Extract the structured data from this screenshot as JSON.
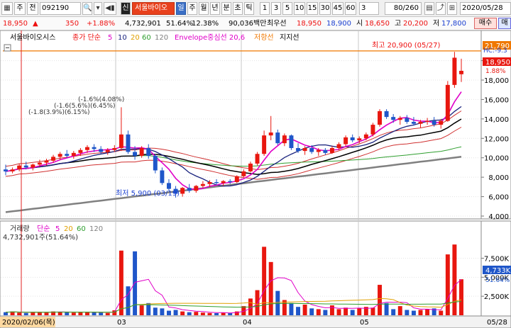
{
  "toolbar": {
    "menu_icon": "▦",
    "market_label": "주",
    "prev_label": "전",
    "code": "092190",
    "search_icon": "🔍",
    "window_icons": [
      "▾",
      "◀",
      "▶"
    ],
    "speaker_icon": "◀▮",
    "sin_label": "신",
    "stock_name": "서울바이오",
    "periods": [
      "일",
      "주",
      "월",
      "년",
      "분",
      "초",
      "틱"
    ],
    "minute_options": [
      "1",
      "3",
      "5",
      "10",
      "15",
      "30",
      "45",
      "60"
    ],
    "interval_value": "3",
    "count_value": "80/260",
    "tool_icons": [
      "▤",
      "⤴",
      "⊞"
    ],
    "date_value": "2020/05/28"
  },
  "info": {
    "price": "18,950",
    "arrow": "▲",
    "change": "350",
    "change_rate": "+1.88%",
    "volume": "4,732,901",
    "turnover": "51.64%",
    "trade_value_ratio": "12.38%",
    "amount": "90,036백만",
    "priority_label": "최우선",
    "ask": "18,950",
    "bid": "18,900",
    "open_label": "시",
    "open": "18,650",
    "high_label": "고",
    "high": "20,200",
    "low_label": "저",
    "low": "17,800",
    "buy_label": "매수",
    "sell_label": "매"
  },
  "chart": {
    "legend": {
      "name": "서울바이오시스",
      "ma_prefix": "종가 단순",
      "periods": [
        "5",
        "10",
        "20",
        "60",
        "120"
      ],
      "envelope": "Envelope중심선 20,6",
      "resistance": "저항선",
      "support": "지지선"
    },
    "price_axis": {
      "ticks": [
        "20,000",
        "18,000",
        "16,000",
        "14,000",
        "12,000",
        "10,000",
        "8,000",
        "6,000",
        "4,000"
      ],
      "current_price": "18,950",
      "current_rate": "1.88%",
      "resistance_value": "21,790",
      "hc_label": "HC:-9.3"
    },
    "annotations": {
      "high": "최고 20,900 (05/27)",
      "low": "최저 5,900 (03/19)",
      "signals_text": "(-1.6%(4.08%)",
      "signals_text2": "(-1.6(5.6%)(6.45%)",
      "signals_text3": "(-1.8(3.9%)(6.15%)"
    },
    "volume_legend": {
      "name": "거래량",
      "ma_prefix": "단순",
      "periods": [
        "5",
        "20",
        "60",
        "120"
      ],
      "value": "4,732,901주(51.64%)"
    },
    "volume_axis": {
      "ticks": [
        "7,500K",
        "5,000K",
        "2,500K"
      ],
      "current": "4,733K",
      "current_rate": "51.64%"
    },
    "date_axis": {
      "first_date": "2020/02/06(목)",
      "months": [
        "03",
        "04",
        "05"
      ],
      "last": "05/28"
    },
    "colors": {
      "up": "#e8170f",
      "down": "#1f56c9",
      "ma5": "#e000c8",
      "ma10": "#1a237e",
      "ma20": "#000000",
      "ma60": "#2e9e2e",
      "ma120": "#808080",
      "envelope": "#d03030",
      "resistance": "#f07800"
    }
  },
  "chart_data": [
    {
      "type": "candlestick",
      "title": "서울바이오시스",
      "x": [
        "2020-02-06",
        "2020-05-28"
      ],
      "ylim": [
        4000,
        21500
      ],
      "ohlc": [
        [
          8800,
          9300,
          8200,
          8600
        ],
        [
          8600,
          9000,
          8400,
          8800
        ],
        [
          8800,
          9400,
          8600,
          9200
        ],
        [
          9200,
          9600,
          8800,
          9000
        ],
        [
          9000,
          9400,
          8700,
          9300
        ],
        [
          9300,
          9800,
          9100,
          9500
        ],
        [
          9500,
          9900,
          9200,
          9700
        ],
        [
          9700,
          10300,
          9500,
          10100
        ],
        [
          10100,
          10600,
          9800,
          10400
        ],
        [
          10400,
          10800,
          10000,
          10200
        ],
        [
          10200,
          10700,
          9900,
          10500
        ],
        [
          10500,
          11000,
          10200,
          10800
        ],
        [
          10800,
          11300,
          10500,
          11100
        ],
        [
          11100,
          11400,
          10600,
          10900
        ],
        [
          10900,
          11200,
          10400,
          10600
        ],
        [
          10600,
          11000,
          10300,
          10800
        ],
        [
          10800,
          11300,
          10600,
          11000
        ],
        [
          11000,
          15200,
          10700,
          12400
        ],
        [
          12400,
          12800,
          10400,
          10600
        ],
        [
          10600,
          11200,
          9800,
          10200
        ],
        [
          10200,
          11200,
          10000,
          11000
        ],
        [
          11000,
          11400,
          9900,
          10200
        ],
        [
          10200,
          10400,
          8400,
          8700
        ],
        [
          8700,
          9000,
          7200,
          7400
        ],
        [
          7400,
          7800,
          6600,
          6800
        ],
        [
          6800,
          7100,
          5900,
          6300
        ],
        [
          6300,
          7000,
          6000,
          6900
        ],
        [
          6900,
          7300,
          6400,
          6600
        ],
        [
          6600,
          7200,
          6400,
          7100
        ],
        [
          7100,
          7600,
          6900,
          7300
        ],
        [
          7300,
          7700,
          7000,
          7500
        ],
        [
          7500,
          7800,
          7200,
          7400
        ],
        [
          7400,
          7700,
          7100,
          7600
        ],
        [
          7600,
          7800,
          7300,
          7500
        ],
        [
          7500,
          8200,
          7400,
          8100
        ],
        [
          8100,
          8800,
          8000,
          8600
        ],
        [
          8600,
          9600,
          8500,
          9400
        ],
        [
          9400,
          10600,
          9200,
          10400
        ],
        [
          10400,
          12800,
          10200,
          12300
        ],
        [
          12300,
          14300,
          11800,
          12600
        ],
        [
          12600,
          12900,
          11300,
          11500
        ],
        [
          11500,
          12500,
          11200,
          12300
        ],
        [
          12300,
          12400,
          10800,
          11000
        ],
        [
          11000,
          11500,
          10500,
          10700
        ],
        [
          10700,
          11200,
          10300,
          11000
        ],
        [
          11000,
          11300,
          10400,
          10600
        ],
        [
          10600,
          11000,
          10200,
          10800
        ],
        [
          10800,
          11000,
          10300,
          10500
        ],
        [
          10500,
          11200,
          10400,
          11000
        ],
        [
          11000,
          11600,
          10800,
          11400
        ],
        [
          11400,
          12300,
          11200,
          12100
        ],
        [
          12100,
          12400,
          11600,
          11800
        ],
        [
          11800,
          12200,
          11500,
          12000
        ],
        [
          12000,
          12600,
          11800,
          12400
        ],
        [
          12400,
          13600,
          12200,
          13400
        ],
        [
          13400,
          15000,
          13200,
          14800
        ],
        [
          14800,
          15000,
          14000,
          14200
        ],
        [
          14200,
          14500,
          13600,
          13900
        ],
        [
          13900,
          14300,
          13400,
          14100
        ],
        [
          14100,
          14400,
          13500,
          13700
        ],
        [
          13700,
          14200,
          13300,
          13500
        ],
        [
          13500,
          13900,
          13100,
          13700
        ],
        [
          13700,
          14100,
          13400,
          13800
        ],
        [
          13800,
          14200,
          13200,
          13400
        ],
        [
          13400,
          14000,
          13000,
          13800
        ],
        [
          13800,
          17900,
          13700,
          17500
        ],
        [
          17500,
          20900,
          17200,
          20300
        ],
        [
          18600,
          20200,
          17800,
          18950
        ]
      ],
      "ma120": [
        4400,
        10100
      ]
    },
    {
      "type": "bar",
      "title": "거래량",
      "ylim": [
        0,
        9500000
      ],
      "values": [
        400000,
        500000,
        350000,
        300000,
        450000,
        380000,
        420000,
        500000,
        450000,
        380000,
        350000,
        400000,
        450000,
        380000,
        350000,
        300000,
        650000,
        8500000,
        3800000,
        8400000,
        1300000,
        1600000,
        1000000,
        900000,
        600000,
        700000,
        500000,
        400000,
        450000,
        350000,
        300000,
        280000,
        320000,
        300000,
        500000,
        1200000,
        2200000,
        3300000,
        9000000,
        7000000,
        3200000,
        2000000,
        1600000,
        1100000,
        1400000,
        900000,
        800000,
        700000,
        1300000,
        800000,
        1000000,
        700000,
        900000,
        1100000,
        1000000,
        4000000,
        1600000,
        800000,
        1200000,
        700000,
        600000,
        700000,
        800000,
        900000,
        600000,
        8000000,
        9300000,
        4733000
      ]
    }
  ]
}
